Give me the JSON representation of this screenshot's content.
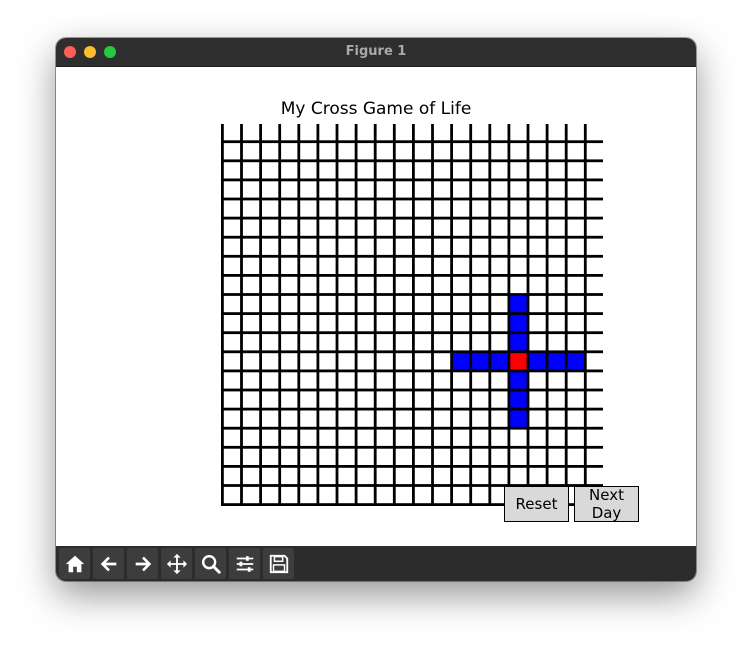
{
  "window": {
    "title": "Figure 1"
  },
  "figure": {
    "title": "My Cross Game of Life"
  },
  "board": {
    "rows": 20,
    "cols": 20,
    "cell_color": "#ffffff",
    "line_color": "#000000",
    "live_color": "#0000ff",
    "center_color": "#ff0000",
    "live_cells": [
      [
        9,
        15
      ],
      [
        10,
        15
      ],
      [
        11,
        15
      ],
      [
        12,
        12
      ],
      [
        12,
        13
      ],
      [
        12,
        14
      ],
      [
        12,
        16
      ],
      [
        12,
        17
      ],
      [
        12,
        18
      ],
      [
        13,
        15
      ],
      [
        14,
        15
      ],
      [
        15,
        15
      ]
    ],
    "center_cell": [
      12,
      15
    ]
  },
  "buttons": {
    "reset_label": "Reset",
    "next_label": "Next Day"
  },
  "toolbar": {
    "items": [
      {
        "name": "home-icon",
        "icon": "home"
      },
      {
        "name": "back-icon",
        "icon": "back"
      },
      {
        "name": "forward-icon",
        "icon": "forward"
      },
      {
        "name": "pan-icon",
        "icon": "pan"
      },
      {
        "name": "zoom-icon",
        "icon": "zoom"
      },
      {
        "name": "configure-subplots-icon",
        "icon": "sliders"
      },
      {
        "name": "save-icon",
        "icon": "save"
      }
    ]
  }
}
